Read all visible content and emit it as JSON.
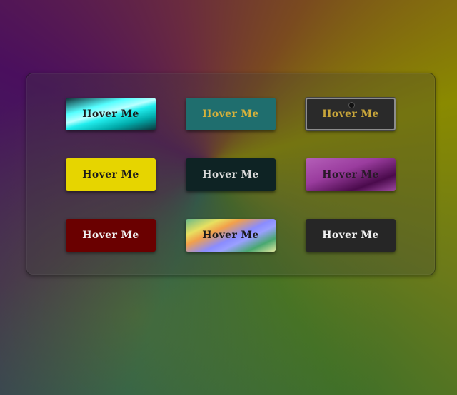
{
  "buttons": [
    {
      "id": "cyan-gradient",
      "label": "Hover Me"
    },
    {
      "id": "teal",
      "label": "Hover Me"
    },
    {
      "id": "dark-outlined",
      "label": "Hover Me"
    },
    {
      "id": "yellow",
      "label": "Hover Me"
    },
    {
      "id": "dark-teal",
      "label": "Hover Me"
    },
    {
      "id": "purple-gradient",
      "label": "Hover Me"
    },
    {
      "id": "maroon",
      "label": "Hover Me"
    },
    {
      "id": "rainbow-gradient",
      "label": "Hover Me"
    },
    {
      "id": "charcoal",
      "label": "Hover Me"
    }
  ],
  "colors": {
    "teal": "#1f6e6e",
    "gold_text": "#d7b23a",
    "yellow": "#e6d500",
    "maroon": "#6a0000",
    "charcoal": "#262626",
    "dark_teal": "#0e2324",
    "purple": "#9a3c9e",
    "cyan": "#5ffafa"
  }
}
